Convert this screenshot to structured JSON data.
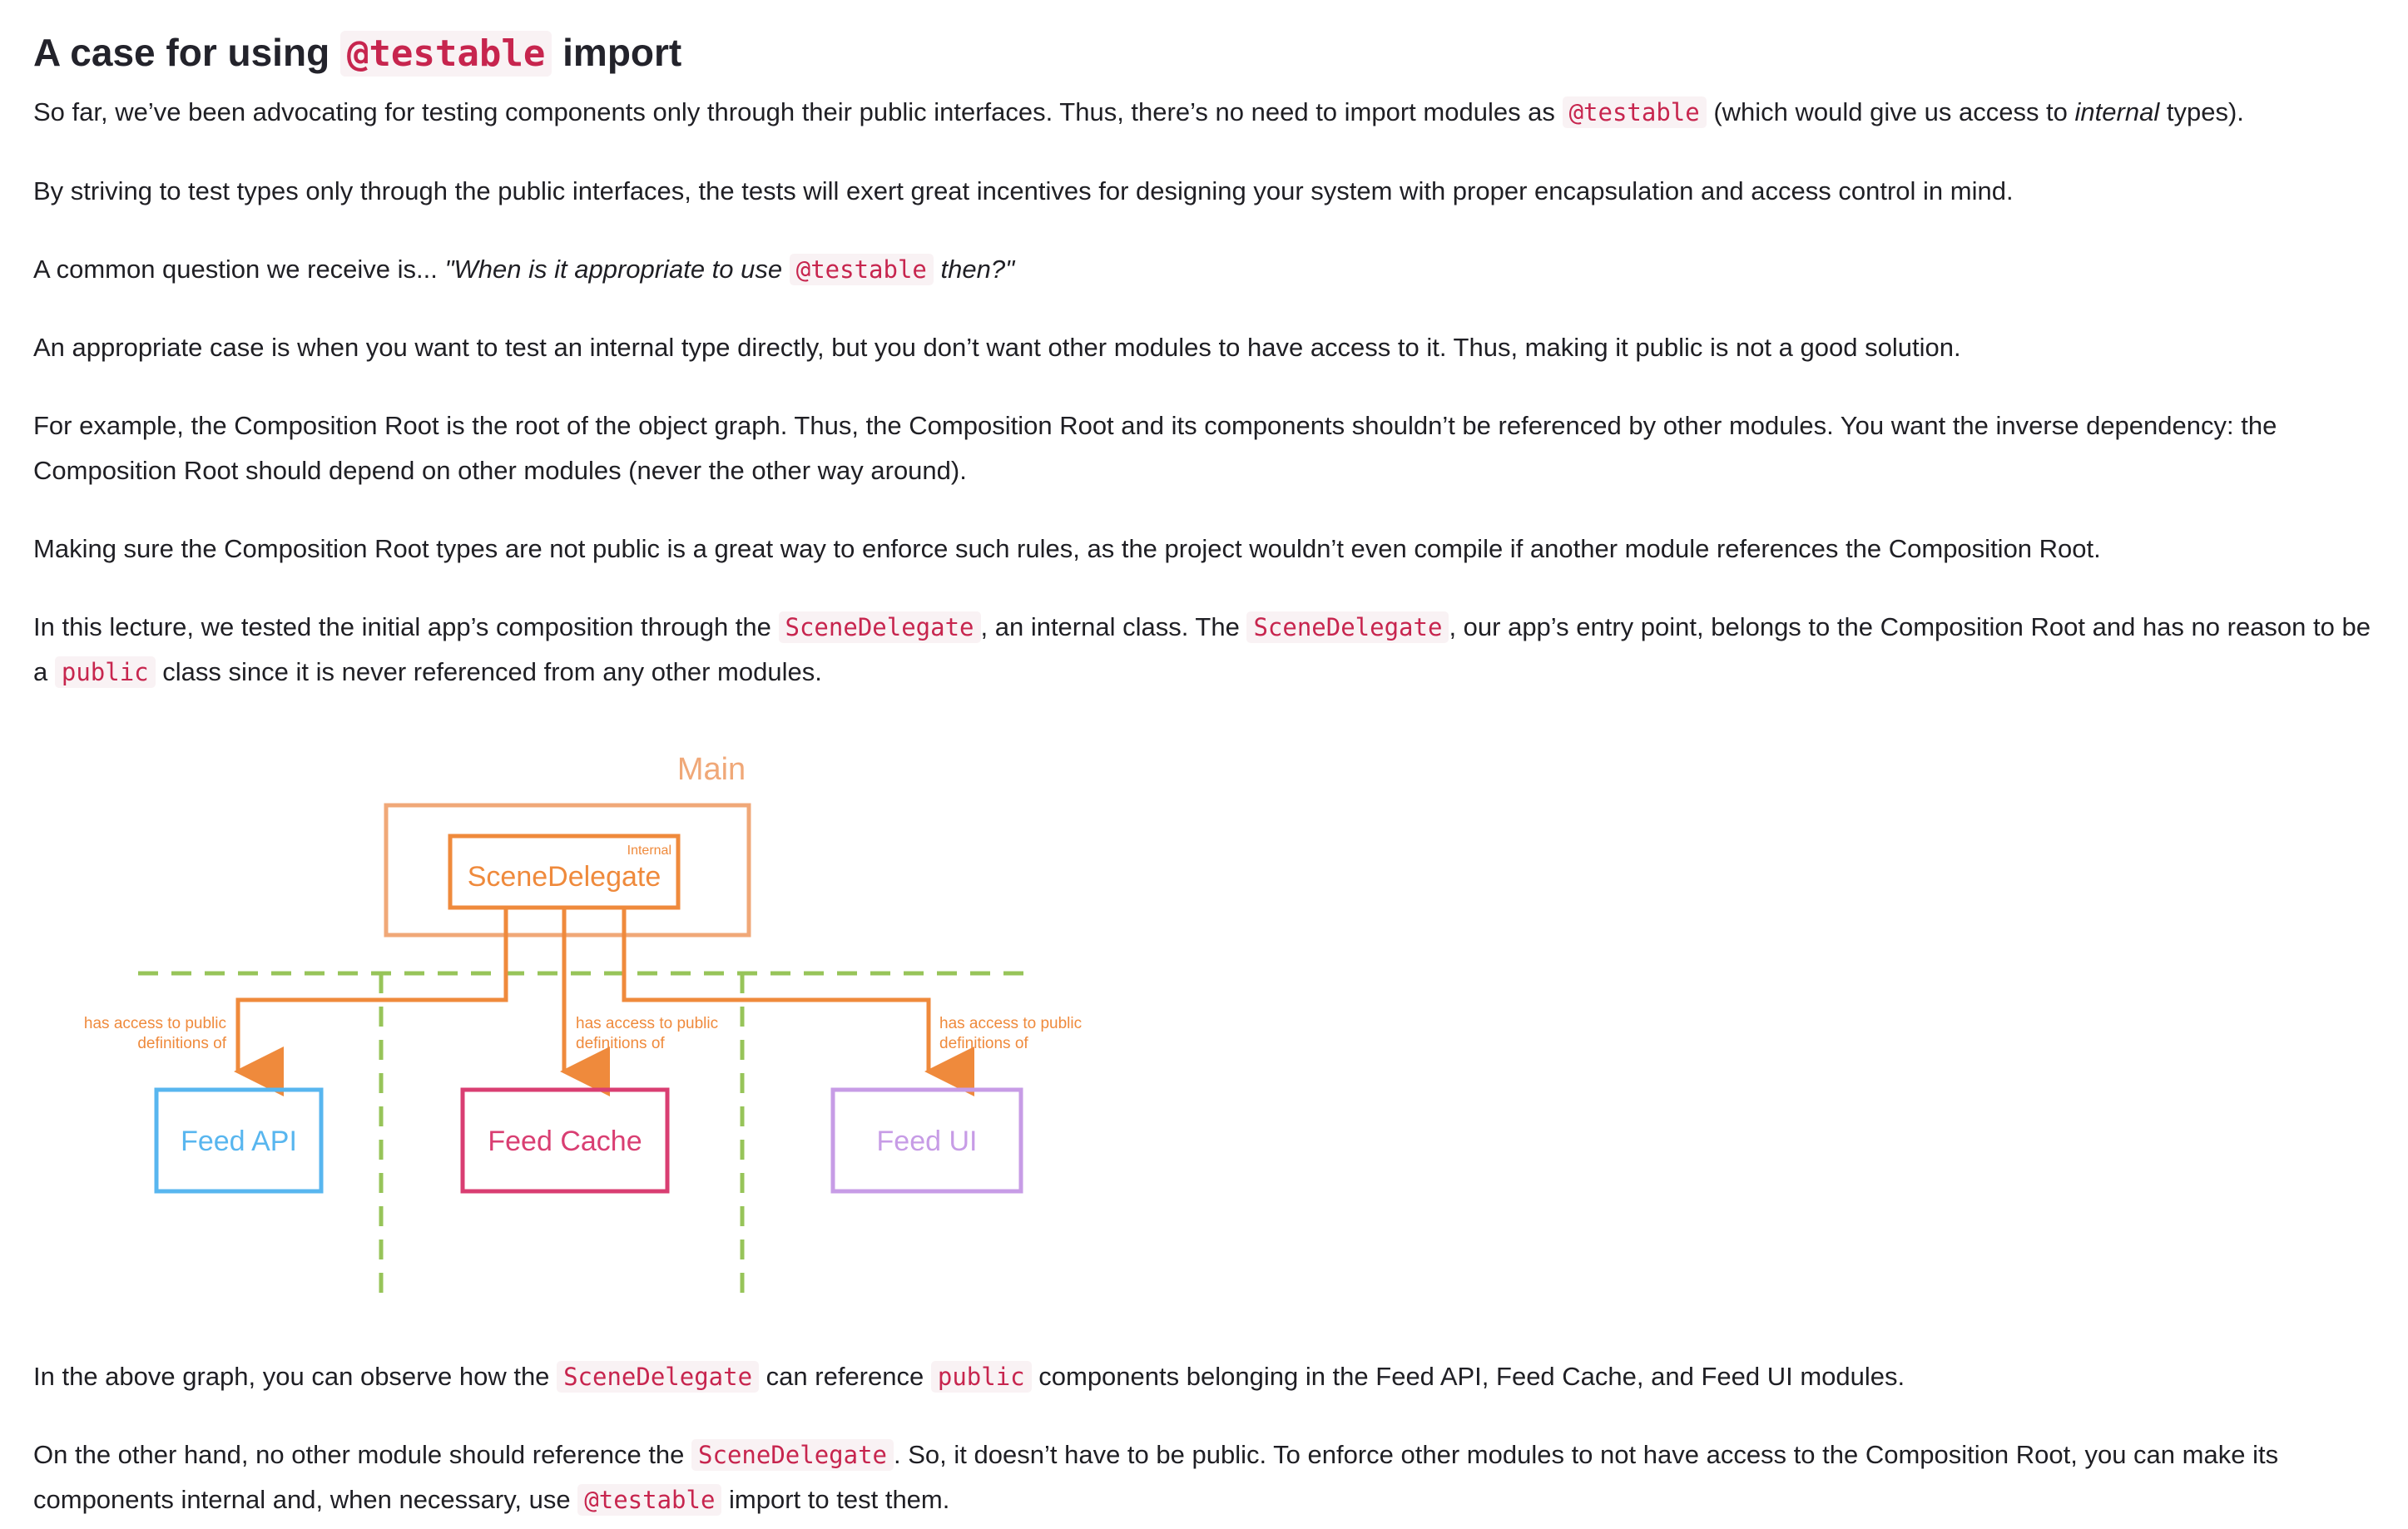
{
  "heading": {
    "prefix": "A case for using",
    "code": "@testable",
    "suffix": "import"
  },
  "paragraphs": {
    "p1": {
      "a": "So far, we’ve been advocating for testing components only through their public interfaces. Thus, there’s no need to import modules as",
      "code": "@testable",
      "b": "(which would give us access to",
      "em": "internal",
      "c": "types)."
    },
    "p2": "By striving to test types only through the public interfaces, the tests will exert great incentives for designing your system with proper encapsulation and access control in mind.",
    "p3": {
      "a": "A common question we receive is...",
      "em_a": "\"When is it appropriate to use",
      "code": "@testable",
      "em_b": "then?\""
    },
    "p4": "An appropriate case is when you want to test an internal type directly, but you don’t want other modules to have access to it. Thus, making it public is not a good solution.",
    "p5": "For example, the Composition Root is the root of the object graph. Thus, the Composition Root and its components shouldn’t be referenced by other modules. You want the inverse dependency: the Composition Root should depend on other modules (never the other way around).",
    "p6": "Making sure the Composition Root types are not public is a great way to enforce such rules, as the project wouldn’t even compile if another module references the Composition Root.",
    "p7": {
      "a": "In this lecture, we tested the initial app’s composition through the",
      "code1": "SceneDelegate",
      "b": ", an internal class. The",
      "code2": "SceneDelegate",
      "c": ", our app’s entry point, belongs to the Composition Root and has no reason to be a",
      "code3": "public",
      "d": "class since it is never referenced from any other modules."
    },
    "p8": {
      "a": "In the above graph, you can observe how the",
      "code1": "SceneDelegate",
      "b": "can reference",
      "code2": "public",
      "c": "components belonging in the Feed API, Feed Cache, and Feed UI modules."
    },
    "p9": {
      "a": "On the other hand, no other module should reference the",
      "code1": "SceneDelegate",
      "b": ". So, it doesn’t have to be public. To enforce other modules to not have access to the Composition Root, you can make its components internal and, when necessary, use",
      "code2": "@testable",
      "c": "import to test them."
    }
  },
  "diagram": {
    "main_label": "Main",
    "internal_label": "Internal",
    "scene_delegate": "SceneDelegate",
    "access_line1": "has access to public",
    "access_line2": "definitions of",
    "modules": {
      "feed_api": "Feed API",
      "feed_cache": "Feed Cache",
      "feed_ui": "Feed UI"
    },
    "colors": {
      "main": "#f0a878",
      "scene_delegate": "#ef8a3c",
      "boundary": "#97c459",
      "feed_api": "#58b6ef",
      "feed_cache": "#d93e72",
      "feed_ui": "#c79ce6"
    }
  }
}
